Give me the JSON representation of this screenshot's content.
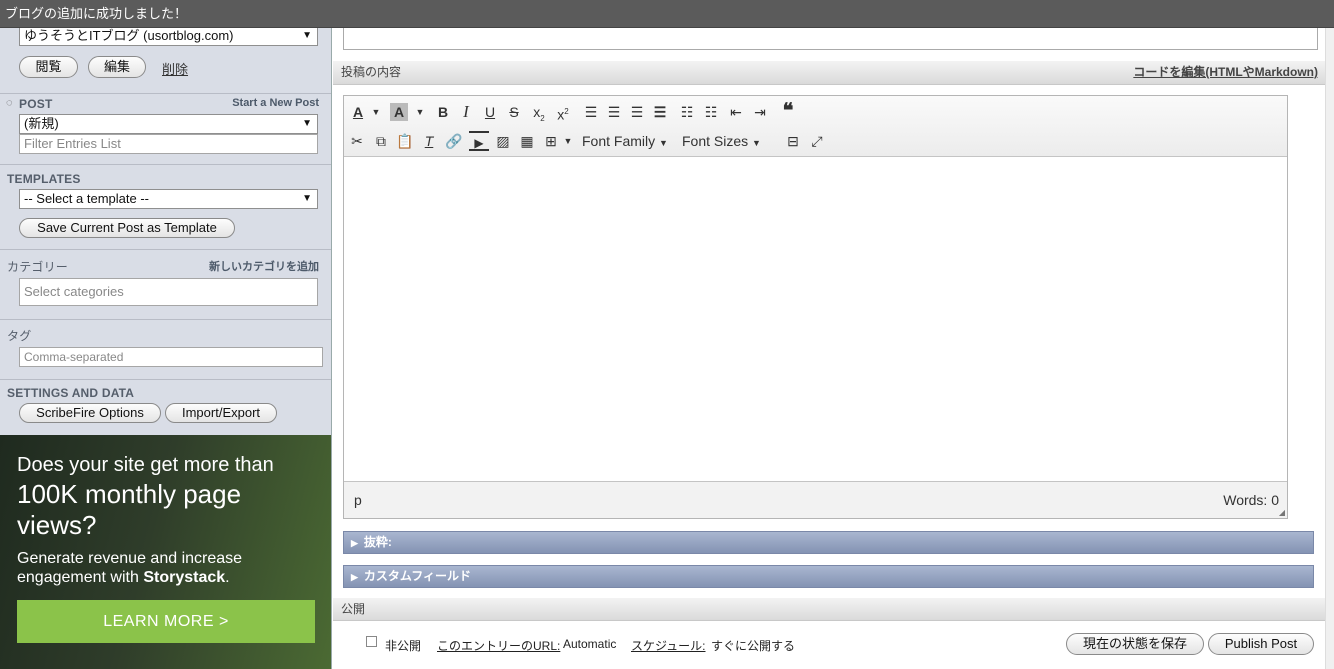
{
  "notice": "ブログの追加に成功しました！",
  "blog": {
    "selected": "ゆうそうとITブログ (usortblog.com)",
    "view": "閲覧",
    "edit": "編集",
    "delete": "削除"
  },
  "post": {
    "title": "POST",
    "new_link": "Start a New Post",
    "selected": "(新規)",
    "filter_placeholder": "Filter Entries List"
  },
  "templates": {
    "title": "TEMPLATES",
    "selected": "-- Select a template --",
    "save_button": "Save Current Post as Template"
  },
  "category": {
    "title": "カテゴリー",
    "add_link": "新しいカテゴリを追加",
    "placeholder": "Select categories"
  },
  "tags": {
    "title": "タグ",
    "placeholder": "Comma-separated"
  },
  "settings": {
    "title": "SETTINGS AND DATA",
    "options_button": "ScribeFire Options",
    "import_button": "Import/Export"
  },
  "ad": {
    "line1": "Does your site get more than",
    "line2": "100K monthly page views?",
    "body_prefix": "Generate revenue and increase engagement with ",
    "body_brand": "Storystack",
    "body_suffix": ".",
    "cta": "LEARN MORE >"
  },
  "editor": {
    "section_label": "投稿の内容",
    "code_link": "コードを編集(HTMLやMarkdown)",
    "font_family": "Font Family",
    "font_sizes": "Font Sizes",
    "path": "p",
    "word_count": "Words: 0",
    "icons": [
      "text-color-icon",
      "background-color-icon",
      "bold-icon",
      "italic-icon",
      "underline-icon",
      "strikethrough-icon",
      "subscript-icon",
      "superscript-icon",
      "align-left-icon",
      "align-center-icon",
      "align-right-icon",
      "justify-icon",
      "bullet-list-icon",
      "numbered-list-icon",
      "outdent-icon",
      "indent-icon",
      "blockquote-icon",
      "cut-icon",
      "copy-icon",
      "paste-icon",
      "clear-format-icon",
      "link-icon",
      "media-icon",
      "image-icon",
      "video-icon",
      "table-icon",
      "page-break-icon",
      "fullscreen-icon"
    ]
  },
  "excerpt": {
    "label": "抜粋:"
  },
  "custom_fields": {
    "label": "カスタムフィールド"
  },
  "publish": {
    "section_label": "公開",
    "private_label": "非公開",
    "url_label": "このエントリーのURL:",
    "url_value": "Automatic",
    "schedule_label": "スケジュール:",
    "schedule_value": "すぐに公開する",
    "save_button": "現在の状態を保存",
    "publish_button": "Publish Post"
  }
}
